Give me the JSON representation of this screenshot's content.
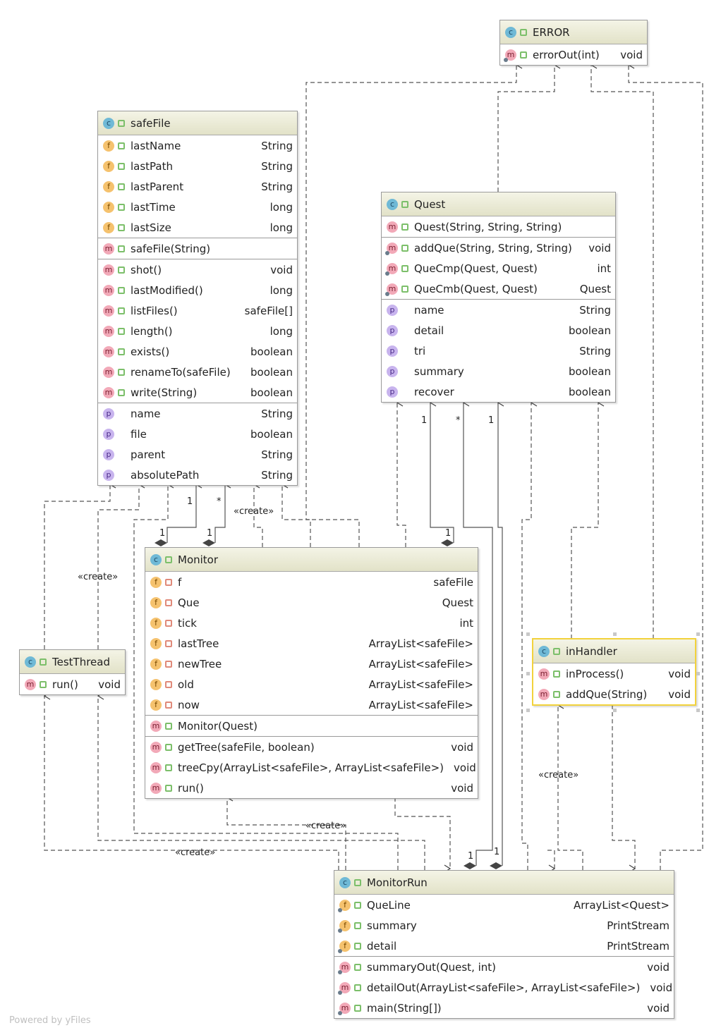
{
  "classes": [
    {
      "id": "ERROR",
      "name": "ERROR",
      "icon": "c",
      "sections": [
        [
          {
            "icon": "m",
            "static": true,
            "vis": "public",
            "name": "errorOut(int)",
            "type": "void"
          }
        ]
      ]
    },
    {
      "id": "safeFile",
      "name": "safeFile",
      "icon": "c",
      "sections": [
        [
          {
            "icon": "f",
            "vis": "public",
            "name": "lastName",
            "type": "String"
          },
          {
            "icon": "f",
            "vis": "public",
            "name": "lastPath",
            "type": "String"
          },
          {
            "icon": "f",
            "vis": "public",
            "name": "lastParent",
            "type": "String"
          },
          {
            "icon": "f",
            "vis": "public",
            "name": "lastTime",
            "type": "long"
          },
          {
            "icon": "f",
            "vis": "public",
            "name": "lastSize",
            "type": "long"
          }
        ],
        [
          {
            "icon": "m",
            "vis": "public",
            "name": "safeFile(String)",
            "type": ""
          }
        ],
        [
          {
            "icon": "m",
            "vis": "public",
            "name": "shot()",
            "type": "void"
          },
          {
            "icon": "m",
            "vis": "public",
            "name": "lastModified()",
            "type": "long"
          },
          {
            "icon": "m",
            "vis": "public",
            "name": "listFiles()",
            "type": "safeFile[]"
          },
          {
            "icon": "m",
            "vis": "public",
            "name": "length()",
            "type": "long"
          },
          {
            "icon": "m",
            "vis": "public",
            "name": "exists()",
            "type": "boolean"
          },
          {
            "icon": "m",
            "vis": "public",
            "name": "renameTo(safeFile)",
            "type": "boolean"
          },
          {
            "icon": "m",
            "vis": "public",
            "name": "write(String)",
            "type": "boolean"
          }
        ],
        [
          {
            "icon": "p",
            "vis": "none",
            "name": "name",
            "type": "String"
          },
          {
            "icon": "p",
            "vis": "none",
            "name": "file",
            "type": "boolean"
          },
          {
            "icon": "p",
            "vis": "none",
            "name": "parent",
            "type": "String"
          },
          {
            "icon": "p",
            "vis": "none",
            "name": "absolutePath",
            "type": "String"
          }
        ]
      ]
    },
    {
      "id": "Quest",
      "name": "Quest",
      "icon": "c",
      "sections": [
        [
          {
            "icon": "m",
            "vis": "public",
            "name": "Quest(String, String, String)",
            "type": ""
          }
        ],
        [
          {
            "icon": "m",
            "static": true,
            "vis": "public",
            "name": "addQue(String, String, String)",
            "type": "void"
          },
          {
            "icon": "m",
            "static": true,
            "vis": "public",
            "name": "QueCmp(Quest, Quest)",
            "type": "int"
          },
          {
            "icon": "m",
            "static": true,
            "vis": "public",
            "name": "QueCmb(Quest, Quest)",
            "type": "Quest"
          }
        ],
        [
          {
            "icon": "p",
            "vis": "none",
            "name": "name",
            "type": "String"
          },
          {
            "icon": "p",
            "vis": "none",
            "name": "detail",
            "type": "boolean"
          },
          {
            "icon": "p",
            "vis": "none",
            "name": "tri",
            "type": "String"
          },
          {
            "icon": "p",
            "vis": "none",
            "name": "summary",
            "type": "boolean"
          },
          {
            "icon": "p",
            "vis": "none",
            "name": "recover",
            "type": "boolean"
          }
        ]
      ]
    },
    {
      "id": "Monitor",
      "name": "Monitor",
      "icon": "c",
      "sections": [
        [
          {
            "icon": "f",
            "vis": "private",
            "name": "f",
            "type": "safeFile"
          },
          {
            "icon": "f",
            "vis": "private",
            "name": "Que",
            "type": "Quest"
          },
          {
            "icon": "f",
            "vis": "private",
            "name": "tick",
            "type": "int"
          },
          {
            "icon": "f",
            "vis": "private",
            "name": "lastTree",
            "type": "ArrayList<safeFile>"
          },
          {
            "icon": "f",
            "vis": "private",
            "name": "newTree",
            "type": "ArrayList<safeFile>"
          },
          {
            "icon": "f",
            "vis": "private",
            "name": "old",
            "type": "ArrayList<safeFile>"
          },
          {
            "icon": "f",
            "vis": "private",
            "name": "now",
            "type": "ArrayList<safeFile>"
          }
        ],
        [
          {
            "icon": "m",
            "vis": "public",
            "name": "Monitor(Quest)",
            "type": ""
          }
        ],
        [
          {
            "icon": "m",
            "vis": "public",
            "name": "getTree(safeFile, boolean)",
            "type": "void"
          },
          {
            "icon": "m",
            "vis": "public",
            "name": "treeCpy(ArrayList<safeFile>, ArrayList<safeFile>)",
            "type": "void"
          },
          {
            "icon": "m",
            "vis": "public",
            "name": "run()",
            "type": "void"
          }
        ]
      ]
    },
    {
      "id": "TestThread",
      "name": "TestThread",
      "icon": "c",
      "sections": [
        [
          {
            "icon": "m",
            "vis": "public",
            "name": "run()",
            "type": "void"
          }
        ]
      ]
    },
    {
      "id": "inHandler",
      "name": "inHandler",
      "icon": "c",
      "selected": true,
      "sections": [
        [
          {
            "icon": "m",
            "vis": "public",
            "name": "inProcess()",
            "type": "void"
          },
          {
            "icon": "m",
            "vis": "public",
            "name": "addQue(String)",
            "type": "void"
          }
        ]
      ]
    },
    {
      "id": "MonitorRun",
      "name": "MonitorRun",
      "icon": "c",
      "sections": [
        [
          {
            "icon": "f",
            "static": true,
            "vis": "public",
            "name": "QueLine",
            "type": "ArrayList<Quest>"
          },
          {
            "icon": "f",
            "static": true,
            "vis": "public",
            "name": "summary",
            "type": "PrintStream"
          },
          {
            "icon": "f",
            "static": true,
            "vis": "public",
            "name": "detail",
            "type": "PrintStream"
          }
        ],
        [
          {
            "icon": "m",
            "static": true,
            "vis": "public",
            "name": "summaryOut(Quest, int)",
            "type": "void"
          },
          {
            "icon": "m",
            "static": true,
            "vis": "public",
            "name": "detailOut(ArrayList<safeFile>, ArrayList<safeFile>)",
            "type": "void"
          },
          {
            "icon": "m",
            "static": true,
            "vis": "public",
            "name": "main(String[])",
            "type": "void"
          }
        ]
      ]
    }
  ],
  "edge_labels": [
    "1",
    "1",
    "1",
    "*",
    "«create»",
    "«create»",
    "1",
    "1",
    "*",
    "1",
    "«create»",
    "«create»",
    "«create»",
    "1",
    "1"
  ],
  "footer": "Powered by yFiles",
  "colors": {
    "header": "#e8e8d0",
    "selected": "#f2d23c",
    "border": "#9a9a9a"
  }
}
